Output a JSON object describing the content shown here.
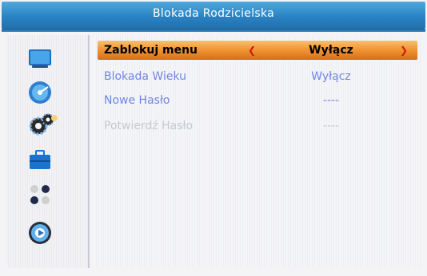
{
  "window": {
    "title": "Blokada Rodzicielska"
  },
  "sidebar": {
    "items": [
      {
        "icon": "tv-icon"
      },
      {
        "icon": "disc-icon"
      },
      {
        "icon": "settings-gears-icon"
      },
      {
        "icon": "toolbox-icon"
      },
      {
        "icon": "dots-icon"
      },
      {
        "icon": "media-disc-icon"
      }
    ]
  },
  "menu": {
    "rows": [
      {
        "label": "Zablokuj menu",
        "value": "Wyłącz"
      },
      {
        "label": "Blokada Wieku",
        "value": "Wyłącz"
      },
      {
        "label": "Nowe Hasło",
        "value": "----"
      },
      {
        "label": "Potwierdź Hasło",
        "value": "----"
      }
    ],
    "arrow_left": "❮",
    "arrow_right": "❯"
  },
  "colors": {
    "title_bar": "#2a83c4",
    "selected_row": "#f39a3b",
    "active_text": "#6f86e6",
    "disabled_text": "#c5c8d4"
  }
}
